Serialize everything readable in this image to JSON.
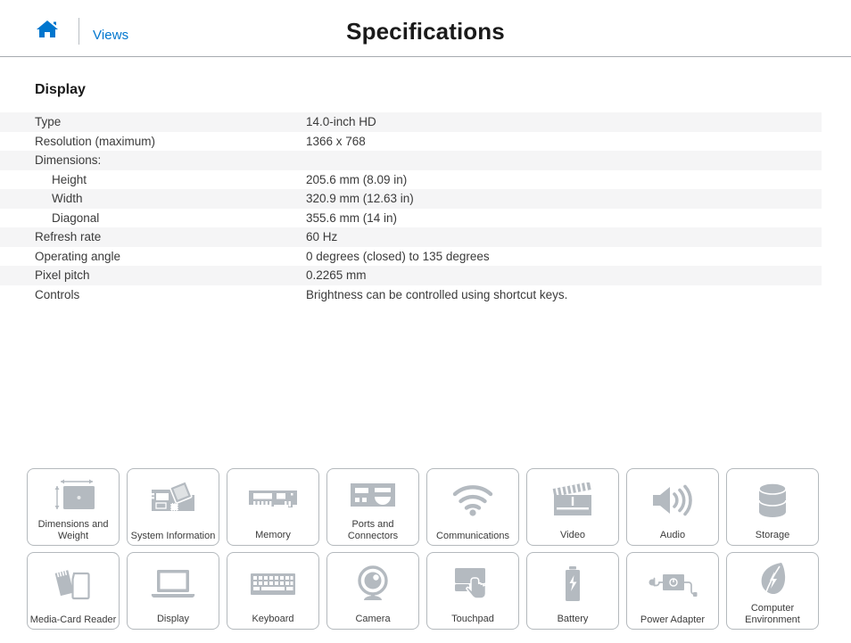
{
  "header": {
    "home_icon": "home-icon",
    "views_label": "Views",
    "title": "Specifications"
  },
  "section": {
    "title": "Display"
  },
  "spec_table": {
    "rows": [
      {
        "label": "Type",
        "value": "14.0-inch HD",
        "indent": false,
        "striped": true
      },
      {
        "label": "Resolution (maximum)",
        "value": "1366 x 768",
        "indent": false,
        "striped": false
      },
      {
        "label": "Dimensions:",
        "value": "",
        "indent": false,
        "striped": true
      },
      {
        "label": "Height",
        "value": "205.6 mm (8.09 in)",
        "indent": true,
        "striped": false
      },
      {
        "label": "Width",
        "value": "320.9 mm (12.63 in)",
        "indent": true,
        "striped": true
      },
      {
        "label": "Diagonal",
        "value": "355.6 mm (14 in)",
        "indent": true,
        "striped": false
      },
      {
        "label": "Refresh rate",
        "value": "60 Hz",
        "indent": false,
        "striped": true
      },
      {
        "label": "Operating angle",
        "value": "0 degrees (closed) to 135 degrees",
        "indent": false,
        "striped": false
      },
      {
        "label": "Pixel pitch",
        "value": "0.2265 mm",
        "indent": false,
        "striped": true
      },
      {
        "label": "Controls",
        "value": "Brightness can be controlled using shortcut keys.",
        "indent": false,
        "striped": false
      }
    ]
  },
  "tiles": {
    "row1": [
      {
        "label": "Dimensions and Weight",
        "icon": "laptop-dimensions-icon"
      },
      {
        "label": "System Information",
        "icon": "motherboard-icon"
      },
      {
        "label": "Memory",
        "icon": "memory-module-icon"
      },
      {
        "label": "Ports and Connectors",
        "icon": "ports-icon"
      },
      {
        "label": "Communications",
        "icon": "wifi-icon"
      },
      {
        "label": "Video",
        "icon": "clapperboard-icon"
      },
      {
        "label": "Audio",
        "icon": "speaker-icon"
      },
      {
        "label": "Storage",
        "icon": "drive-cylinder-icon"
      }
    ],
    "row2": [
      {
        "label": "Media-Card Reader",
        "icon": "memory-card-icon"
      },
      {
        "label": "Display",
        "icon": "laptop-screen-icon"
      },
      {
        "label": "Keyboard",
        "icon": "keyboard-icon"
      },
      {
        "label": "Camera",
        "icon": "webcam-icon"
      },
      {
        "label": "Touchpad",
        "icon": "touchpad-hand-icon"
      },
      {
        "label": "Battery",
        "icon": "battery-icon"
      },
      {
        "label": "Power Adapter",
        "icon": "power-adapter-icon"
      },
      {
        "label": "Computer Environment",
        "icon": "leaf-icon"
      }
    ]
  },
  "colors": {
    "accent_blue": "#0076ce",
    "icon_gray": "#b4bac0",
    "stripe": "#f5f5f6",
    "border": "#b4b9bd",
    "text": "#3b3b3b"
  }
}
